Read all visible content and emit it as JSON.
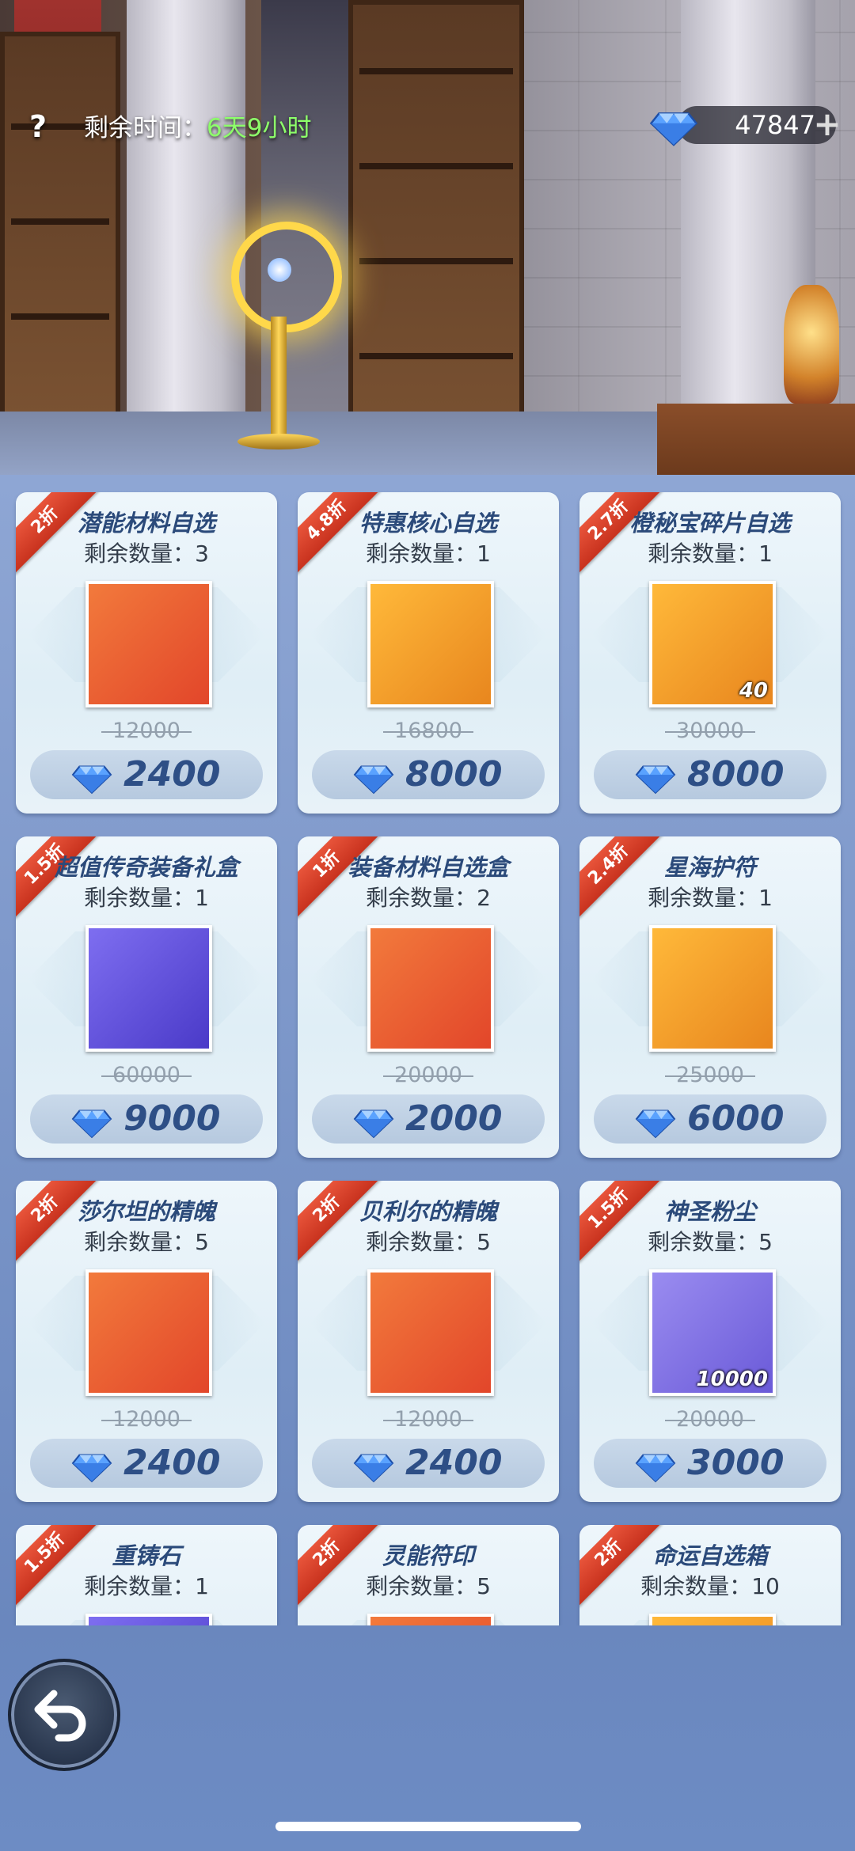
{
  "header": {
    "help_icon_label": "?",
    "timer_label": "剩余时间：",
    "timer_value": "6天9小时",
    "currency": {
      "amount": "47847",
      "plus_label": "+",
      "icon": "blue-diamond-icon"
    }
  },
  "shop": {
    "qty_label": "剩余数量：",
    "items": [
      {
        "discount": "2折",
        "name": "潜能材料自选",
        "remaining": "3",
        "original": "12000",
        "price": "2400",
        "icon": "chest-icon",
        "stack": "",
        "art": "linear-gradient(135deg,#f27a3c,#e2462a)"
      },
      {
        "discount": "4.8折",
        "name": "特惠核心自选",
        "remaining": "1",
        "original": "16800",
        "price": "8000",
        "icon": "core-card-icon",
        "stack": "",
        "art": "linear-gradient(135deg,#ffb93a,#e8861e)"
      },
      {
        "discount": "2.7折",
        "name": "橙秘宝碎片自选",
        "remaining": "1",
        "original": "30000",
        "price": "8000",
        "icon": "treasure-altar-icon",
        "stack": "40",
        "art": "linear-gradient(135deg,#ffb93a,#e8861e)"
      },
      {
        "discount": "1.5折",
        "name": "超值传奇装备礼盒",
        "remaining": "1",
        "original": "60000",
        "price": "9000",
        "icon": "armor-icon",
        "stack": "",
        "art": "linear-gradient(135deg,#7e6ef0,#4a3ac8)"
      },
      {
        "discount": "1折",
        "name": "装备材料自选盒",
        "remaining": "2",
        "original": "20000",
        "price": "2000",
        "icon": "armor-icon",
        "stack": "",
        "art": "linear-gradient(135deg,#f27a3c,#e2462a)"
      },
      {
        "discount": "2.4折",
        "name": "星海护符",
        "remaining": "1",
        "original": "25000",
        "price": "6000",
        "icon": "amulet-icon",
        "stack": "",
        "art": "linear-gradient(135deg,#ffb93a,#e8861e)"
      },
      {
        "discount": "2折",
        "name": "莎尔坦的精魄",
        "remaining": "5",
        "original": "12000",
        "price": "2400",
        "icon": "dark-spirit-orb-icon",
        "stack": "",
        "art": "linear-gradient(135deg,#f27a3c,#e2462a)"
      },
      {
        "discount": "2折",
        "name": "贝利尔的精魄",
        "remaining": "5",
        "original": "12000",
        "price": "2400",
        "icon": "red-spirit-orb-icon",
        "stack": "",
        "art": "linear-gradient(135deg,#f27a3c,#e2462a)"
      },
      {
        "discount": "1.5折",
        "name": "神圣粉尘",
        "remaining": "5",
        "original": "20000",
        "price": "3000",
        "icon": "holy-dust-icon",
        "stack": "10000",
        "art": "linear-gradient(135deg,#9a8cf0,#6a5ad8)"
      },
      {
        "discount": "1.5折",
        "name": "重铸石",
        "remaining": "1",
        "original": "",
        "price": "",
        "icon": "reforge-stone-icon",
        "stack": "",
        "art": "linear-gradient(135deg,#7e6ef0,#4a3ac8)"
      },
      {
        "discount": "2折",
        "name": "灵能符印",
        "remaining": "5",
        "original": "",
        "price": "",
        "icon": "psionic-seal-icon",
        "stack": "",
        "art": "linear-gradient(135deg,#f27a3c,#e2462a)"
      },
      {
        "discount": "2折",
        "name": "命运自选箱",
        "remaining": "10",
        "original": "",
        "price": "",
        "icon": "fate-box-icon",
        "stack": "",
        "art": "linear-gradient(135deg,#ffb93a,#e8861e)"
      }
    ]
  },
  "nav": {
    "back_icon": "back-arrow-icon"
  }
}
